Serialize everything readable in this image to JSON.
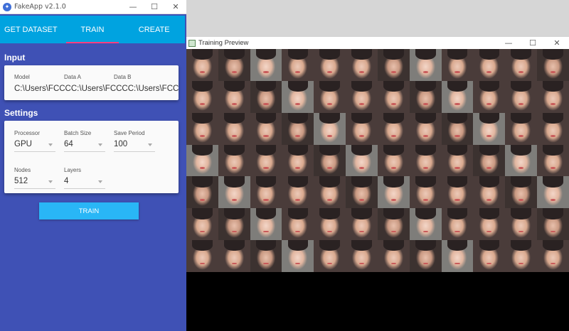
{
  "app": {
    "title": "FakeApp v2.1.0",
    "icon": "app-logo-icon",
    "window_buttons": {
      "minimize": "—",
      "maximize": "☐",
      "close": "✕"
    },
    "tabs": [
      {
        "label": "GET DATASET",
        "active": false
      },
      {
        "label": "TRAIN",
        "active": true
      },
      {
        "label": "CREATE",
        "active": false
      }
    ],
    "accent": "#00a3e0",
    "background": "#3f51b5",
    "tab_indicator": "#ff4081"
  },
  "input": {
    "heading": "Input",
    "model": {
      "label": "Model",
      "value": "C:\\Users\\FCCC"
    },
    "data_a": {
      "label": "Data A",
      "value": "C:\\Users\\FCCC"
    },
    "data_b": {
      "label": "Data B",
      "value": "C:\\Users\\FCC"
    }
  },
  "settings": {
    "heading": "Settings",
    "processor": {
      "label": "Processor",
      "value": "GPU"
    },
    "batch_size": {
      "label": "Batch Size",
      "value": "64"
    },
    "save_period": {
      "label": "Save Period",
      "value": "100"
    },
    "nodes": {
      "label": "Nodes",
      "value": "512"
    },
    "layers": {
      "label": "Layers",
      "value": "4"
    }
  },
  "train_button": {
    "label": "TRAIN",
    "color": "#29b6f6"
  },
  "preview": {
    "title": "Training Preview",
    "window_buttons": {
      "minimize": "—",
      "maximize": "☐",
      "close": "✕"
    },
    "grid": {
      "columns": 12,
      "rows": 7
    }
  }
}
